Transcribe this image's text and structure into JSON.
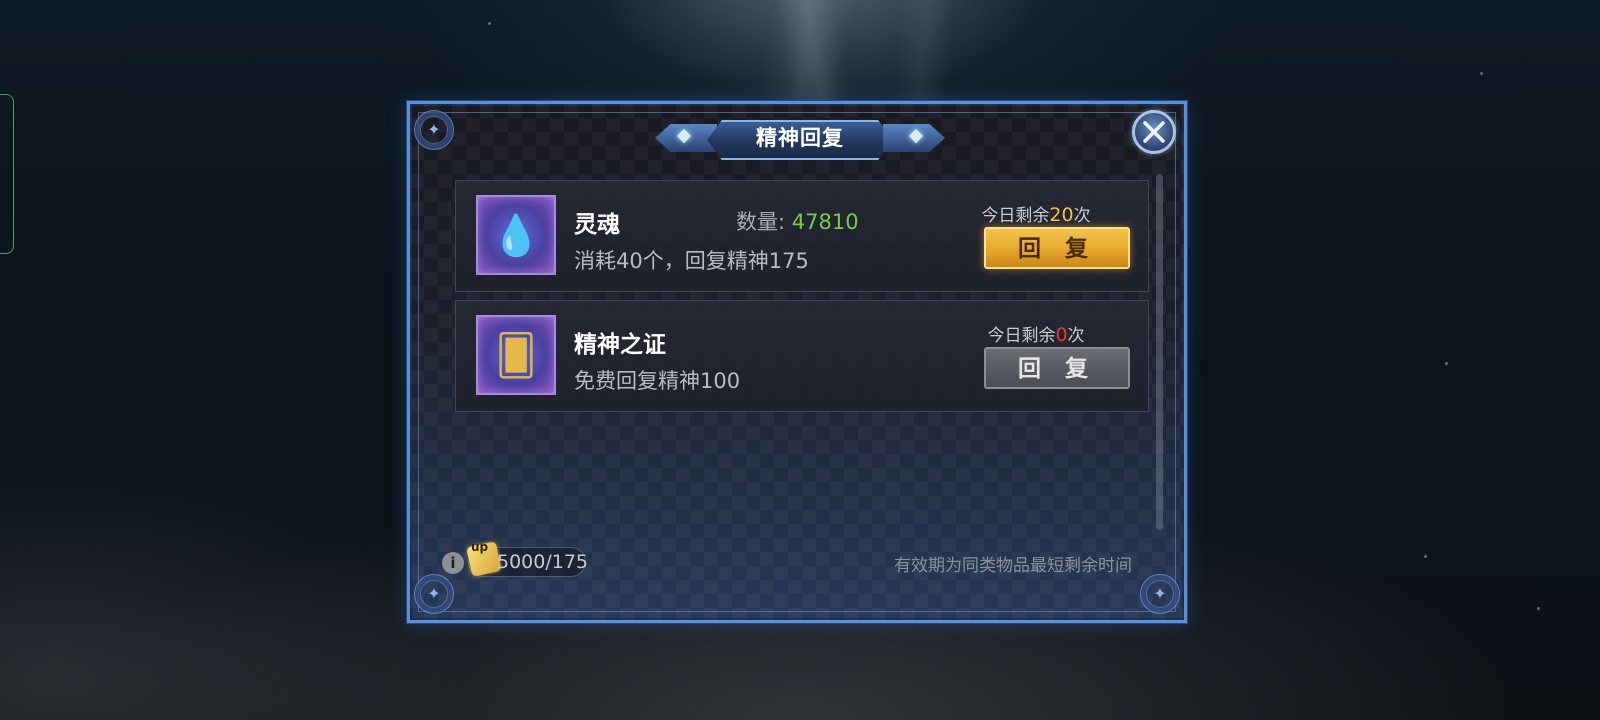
{
  "dialog": {
    "title": "精神回复"
  },
  "items": [
    {
      "name": "灵魂",
      "quantity_label": "数量: ",
      "quantity_value": "47810",
      "description": "消耗40个，回复精神175",
      "remaining_prefix": "今日剩余",
      "remaining_count": "20",
      "remaining_suffix": "次",
      "button_label": "回 复",
      "button_state": "enabled",
      "icon": "soul-gem-icon"
    },
    {
      "name": "精神之证",
      "description": "免费回复精神100",
      "remaining_prefix": "今日剩余",
      "remaining_count": "0",
      "remaining_suffix": "次",
      "button_label": "回 复",
      "button_state": "disabled",
      "icon": "spirit-card-icon"
    }
  ],
  "footer": {
    "up_badge": "up",
    "spirit_count": "5000/175",
    "note": "有效期为同类物品最短剩余时间"
  },
  "colors": {
    "frame": "#5b8fd6",
    "quantity_green": "#6fcf4a",
    "remaining_gold": "#f2c14a",
    "remaining_red": "#e23b2b",
    "button_gold": "#e3a52a",
    "button_gray": "#55585f"
  }
}
